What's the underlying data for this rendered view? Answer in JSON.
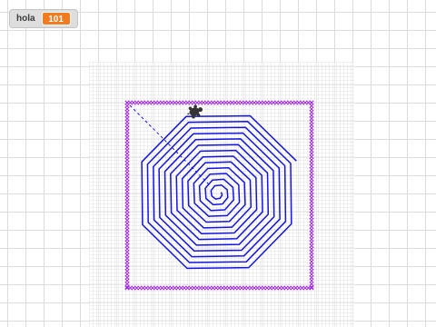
{
  "monitor": {
    "label": "hola",
    "value": "101"
  },
  "colors": {
    "stage_background": "#ffffff",
    "grid_line": "#dcdcdc",
    "monitor_background": "#dedede",
    "monitor_value_background": "#f47a20",
    "spiral_stroke": "#1414e6",
    "frame_stroke": "#a020f0",
    "sprite_fill": "#333333"
  },
  "icons": {
    "sprite": "turtle-sprite-icon"
  }
}
